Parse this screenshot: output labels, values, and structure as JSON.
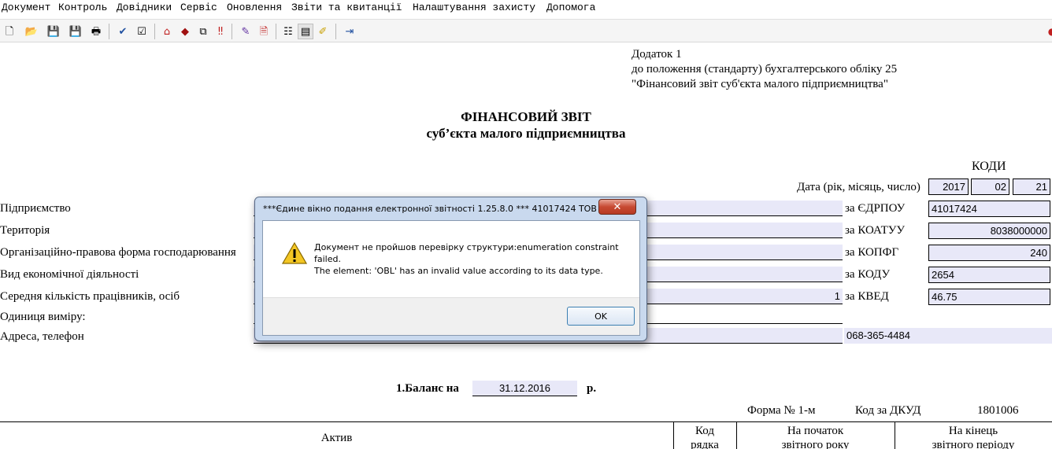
{
  "menu": [
    "Документ",
    "Контроль",
    "Довідники",
    "Сервіс",
    "Оновлення",
    "Звіти та квитанції",
    "Налаштування захисту",
    "Допомога"
  ],
  "toolbar": {
    "icons": [
      "new-document-icon",
      "open-folder-icon",
      "save-icon",
      "save-all-icon",
      "print-icon",
      "check-icon",
      "check-document-icon",
      "home-icon",
      "book-icon",
      "copy-icon",
      "error-list-icon",
      "sign-icon",
      "document-icon",
      "properties-icon",
      "edit-document-icon",
      "highlight-icon",
      "exit-icon"
    ]
  },
  "header": {
    "line1": "Додаток 1",
    "line2": "до положення (стандарту) бухгалтерського обліку 25",
    "line3": "\"Фінансовий звіт суб'єкта малого підприємництва\""
  },
  "title": {
    "main": "ФІНАНСОВИЙ ЗВІТ",
    "sub": "суб’єкта малого підприємництва"
  },
  "codes": {
    "heading": "КОДИ",
    "date_label": "Дата (рік, місяць, число)",
    "year": "2017",
    "month": "02",
    "day": "21"
  },
  "fields": [
    {
      "label": "Підприємство",
      "value": "",
      "code_label": "за ЄДРПОУ",
      "code": "41017424"
    },
    {
      "label": "Територія",
      "value": "",
      "code_label": "за КОАТУУ",
      "code": "8038000000"
    },
    {
      "label": "Організаційно-правова форма господарювання",
      "value": "",
      "code_label": "за КОПФГ",
      "code": "240"
    },
    {
      "label": "Вид економічної діяльності",
      "value": "",
      "code_label": "за КОДУ",
      "code": "2654"
    },
    {
      "label": "Середня кількість працівників, осіб",
      "value": "1",
      "code_label": "за КВЕД",
      "code": "46.75"
    }
  ],
  "unit_label": "Одиниця виміру:",
  "address_label": "Адреса, телефон",
  "phone": "068-365-4484",
  "balance": {
    "label": "1.Баланс на",
    "date": "31.12.2016",
    "suffix": "р."
  },
  "form": {
    "form_label": "Форма № 1-м",
    "dkud_label": "Код за ДКУД",
    "dkud_code": "1801006"
  },
  "table": {
    "col_asset": "Актив",
    "col_code_1": "Код",
    "col_code_2": "рядка",
    "col_start_1": "На початок",
    "col_start_2": "звітного року",
    "col_end_1": "На кінець",
    "col_end_2": "звітного періоду"
  },
  "dialog": {
    "title": "***Єдине вікно подання електронної звітності 1.25.8.0 *** 41017424 ТОВ \"То...",
    "close": "✕",
    "message_lines": [
      "Документ не пройшов перевірку структури:enumeration constraint",
      "failed.",
      "The element: 'OBL'  has an invalid value according to its data type."
    ],
    "ok": "OK"
  }
}
